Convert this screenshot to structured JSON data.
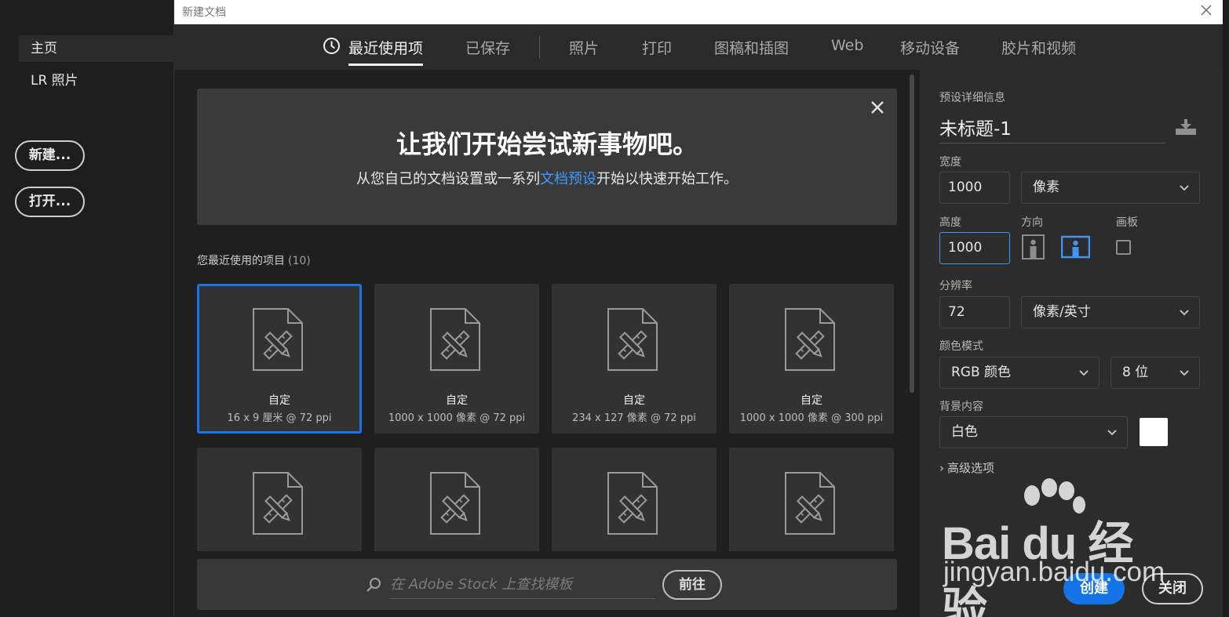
{
  "home": {
    "items": [
      {
        "label": "主页",
        "active": true
      },
      {
        "label": "LR 照片",
        "active": false
      }
    ],
    "new_label": "新建...",
    "open_label": "打开..."
  },
  "dialog": {
    "title": "新建文档",
    "tabs": [
      {
        "label": "最近使用项",
        "active": true
      },
      {
        "label": "已保存"
      },
      {
        "label": "照片"
      },
      {
        "label": "打印"
      },
      {
        "label": "图稿和插图"
      },
      {
        "label": "Web"
      },
      {
        "label": "移动设备"
      },
      {
        "label": "胶片和视频"
      }
    ]
  },
  "banner": {
    "heading": "让我们开始尝试新事物吧。",
    "sub_before": "从您自己的文档设置或一系列",
    "sub_link": "文档预设",
    "sub_after": "开始以快速开始工作。"
  },
  "recent": {
    "label": "您最近使用的项目",
    "count": "(10)",
    "items": [
      {
        "name": "自定",
        "desc": "16 x 9 厘米 @ 72 ppi",
        "selected": true
      },
      {
        "name": "自定",
        "desc": "1000 x 1000 像素 @ 72 ppi"
      },
      {
        "name": "自定",
        "desc": "234 x 127 像素 @ 72 ppi"
      },
      {
        "name": "自定",
        "desc": "1000 x 1000 像素 @ 300 ppi"
      },
      {
        "name": "",
        "desc": ""
      },
      {
        "name": "",
        "desc": ""
      },
      {
        "name": "",
        "desc": ""
      },
      {
        "name": "",
        "desc": ""
      }
    ]
  },
  "stock": {
    "placeholder": "在 Adobe Stock 上查找模板",
    "go_label": "前往"
  },
  "panel": {
    "preset_details_label": "预设详细信息",
    "doc_name": "未标题-1",
    "width_label": "宽度",
    "width_value": "1000",
    "width_unit": "像素",
    "height_label": "高度",
    "height_value": "1000",
    "orientation_label": "方向",
    "artboard_label": "画板",
    "resolution_label": "分辨率",
    "resolution_value": "72",
    "resolution_unit": "像素/英寸",
    "color_mode_label": "颜色模式",
    "color_mode": "RGB 颜色",
    "bit_depth": "8 位",
    "background_label": "背景内容",
    "background": "白色",
    "background_color": "#ffffff",
    "advanced_label": "高级选项",
    "create_label": "创建",
    "close_label": "关闭"
  },
  "watermark": {
    "logo_text": "Bai du 经验",
    "url": "jingyan.baidu.com"
  },
  "colors": {
    "accent": "#1473e6",
    "link": "#3f9bff",
    "selection_border": "#1b73e8"
  }
}
